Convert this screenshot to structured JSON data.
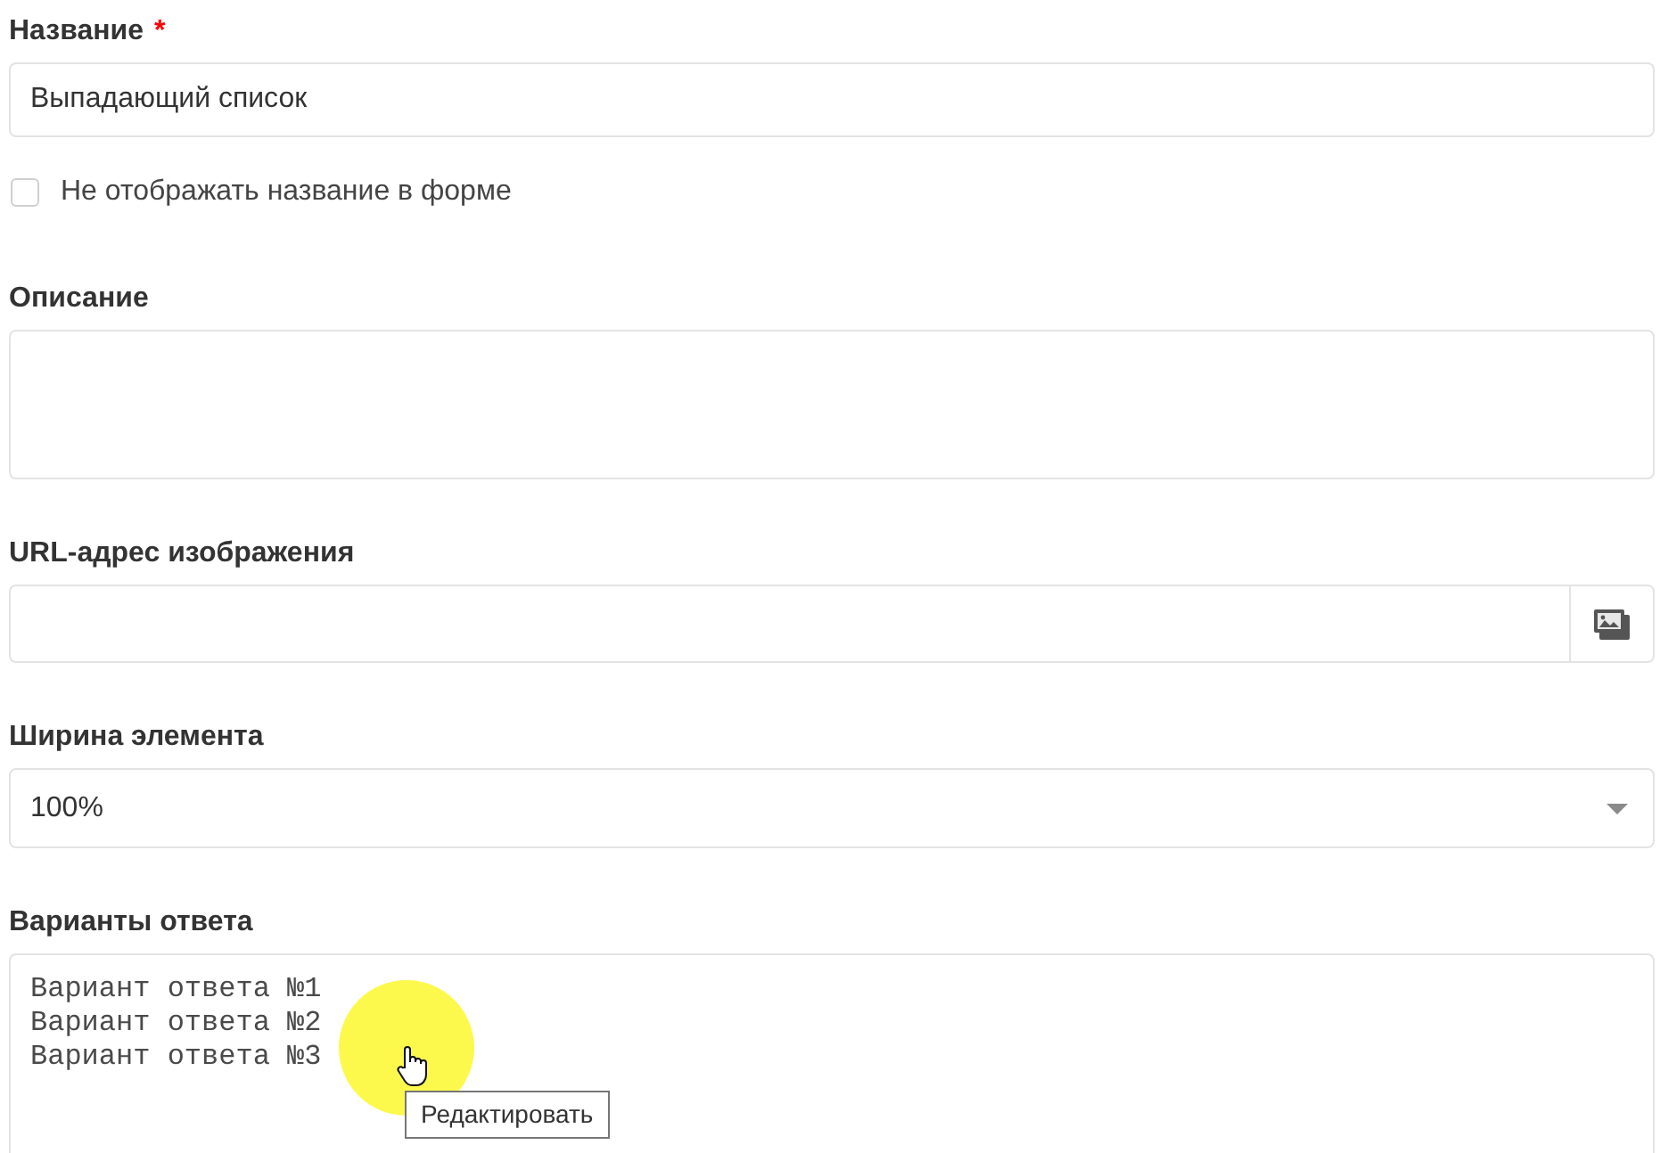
{
  "fields": [
    {
      "kind": "text",
      "label": "Название",
      "required_mark": "*",
      "value": "Выпадающий список"
    },
    {
      "kind": "checkbox",
      "label": "Не отображать название в форме",
      "checked": false
    },
    {
      "kind": "textarea",
      "label": "Описание"
    },
    {
      "kind": "image_url",
      "label": "URL-адрес изображения"
    },
    {
      "kind": "select",
      "label": "Ширина элемента",
      "value": "100%"
    },
    {
      "kind": "options",
      "label": "Варианты ответа",
      "lines": [
        "Вариант ответа №1",
        "Вариант ответа №2",
        "Вариант ответа №3"
      ]
    }
  ],
  "tooltip": {
    "text": "Редактировать"
  }
}
